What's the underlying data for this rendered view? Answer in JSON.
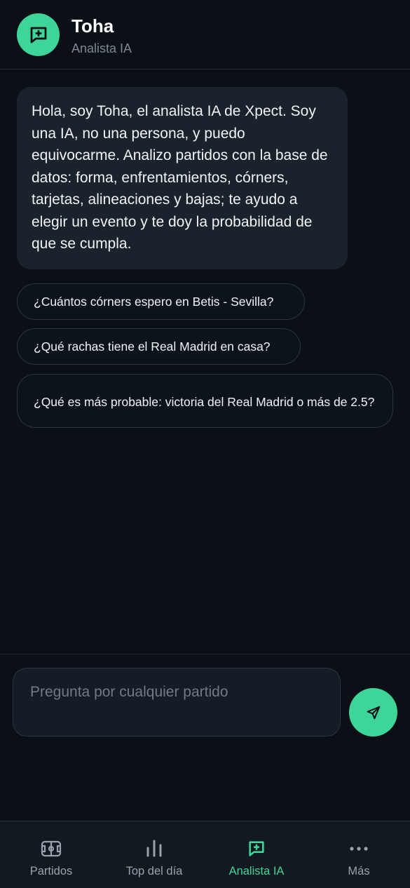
{
  "header": {
    "title": "Toha",
    "subtitle": "Analista IA",
    "avatar_icon": "message-plus-icon"
  },
  "chat": {
    "messages": [
      {
        "role": "assistant",
        "text": "Hola, soy Toha, el analista IA de Xpect. Soy una IA, no una persona, y puedo equivocarme. Analizo partidos con la base de datos: forma, enfrentamientos, córners, tarjetas, alineaciones y bajas; te ayudo a elegir un evento y te doy la probabilidad de que se cumpla."
      }
    ],
    "suggestions": [
      "¿Cuántos córners espero en Betis - Sevilla?",
      "¿Qué rachas tiene el Real Madrid en casa?",
      "¿Qué es más probable: victoria del Real Madrid o más de 2.5?"
    ]
  },
  "composer": {
    "placeholder": "Pregunta por cualquier partido",
    "send_icon": "send-icon"
  },
  "bottom_nav": {
    "items": [
      {
        "label": "Partidos",
        "icon": "pitch-icon",
        "active": false
      },
      {
        "label": "Top del día",
        "icon": "bar-chart-icon",
        "active": false
      },
      {
        "label": "Analista IA",
        "icon": "message-plus-icon",
        "active": true
      },
      {
        "label": "Más",
        "icon": "more-icon",
        "active": false
      }
    ]
  },
  "colors": {
    "background": "#0b1017",
    "accent": "#3dd598",
    "bubble": "#1a222c",
    "muted_text": "#7d8793"
  }
}
